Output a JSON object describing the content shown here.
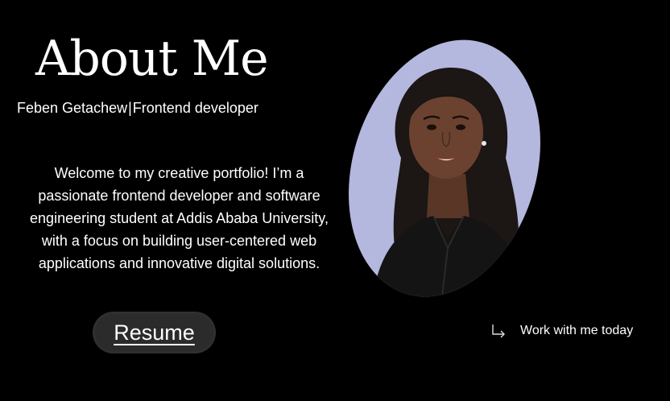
{
  "about": {
    "heading": "About Me",
    "name": "Feben Getachew",
    "separator": "|",
    "role": "Frontend developer",
    "bio": "Welcome to my creative portfolio! I’m a passionate frontend developer and software engineering student at Addis Ababa University, with a focus on building user-centered web applications and innovative digital solutions.",
    "resume_label": "Resume",
    "cta_label": "Work with me today",
    "cta_icon": "arrow-down-right-icon"
  },
  "portrait": {
    "icon": "profile-photo",
    "background": "#b4b7de"
  },
  "colors": {
    "page_background": "#000000",
    "text": "#ffffff",
    "button_background": "#2b2b2b"
  }
}
